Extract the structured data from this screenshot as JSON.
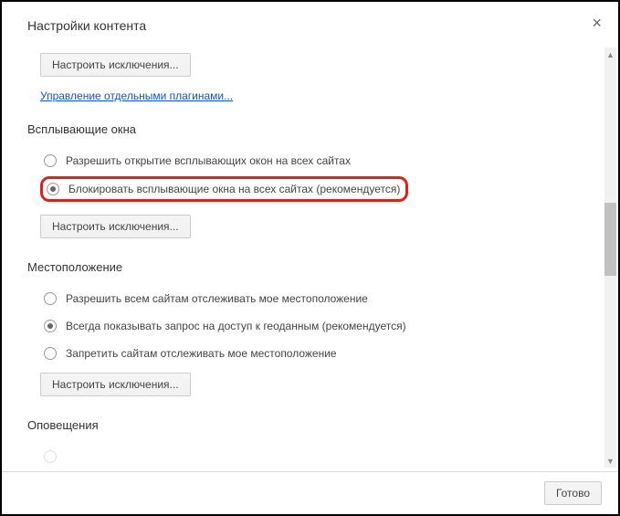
{
  "dialog": {
    "title": "Настройки контента",
    "close": "×"
  },
  "top": {
    "exceptions_btn": "Настроить исключения...",
    "plugins_link": "Управление отдельными плагинами..."
  },
  "popups": {
    "title": "Всплывающие окна",
    "option_allow": "Разрешить открытие всплывающих окон на всех сайтах",
    "option_block": "Блокировать всплывающие окна на всех сайтах (рекомендуется)",
    "exceptions_btn": "Настроить исключения..."
  },
  "location": {
    "title": "Местоположение",
    "option_allow": "Разрешить всем сайтам отслеживать мое местоположение",
    "option_ask": "Всегда показывать запрос на доступ к геоданным (рекомендуется)",
    "option_block": "Запретить сайтам отслеживать мое местоположение",
    "exceptions_btn": "Настроить исключения..."
  },
  "notifications": {
    "title": "Оповещения"
  },
  "footer": {
    "done_btn": "Готово"
  }
}
